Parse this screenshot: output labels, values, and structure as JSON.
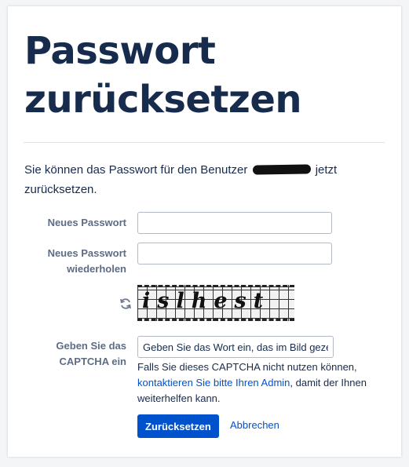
{
  "page": {
    "title_line1": "Passwort",
    "title_line2": "zurücksetzen",
    "intro_before": "Sie können das Passwort für den Benutzer",
    "intro_after": "jetzt zurücksetzen."
  },
  "form": {
    "new_password_label": "Neues Passwort",
    "repeat_password_label_line1": "Neues Passwort",
    "repeat_password_label_line2": "wiederholen",
    "captcha_label_line1": "Geben Sie das",
    "captcha_label_line2": "CAPTCHA ein",
    "captcha_text": "islhest",
    "captcha_placeholder": "Geben Sie das Wort ein, das im Bild gezeigt wird",
    "help_before": "Falls Sie dieses CAPTCHA nicht nutzen können,",
    "help_link": "kontaktieren Sie bitte Ihren Admin",
    "help_after": ", damit der Ihnen weiterhelfen kann."
  },
  "actions": {
    "submit_label": "Zurücksetzen",
    "cancel_label": "Abbrechen"
  },
  "colors": {
    "primary": "#0052cc",
    "heading": "#172b4d",
    "label": "#5e6c84"
  },
  "icons": {
    "refresh": "refresh-icon"
  }
}
